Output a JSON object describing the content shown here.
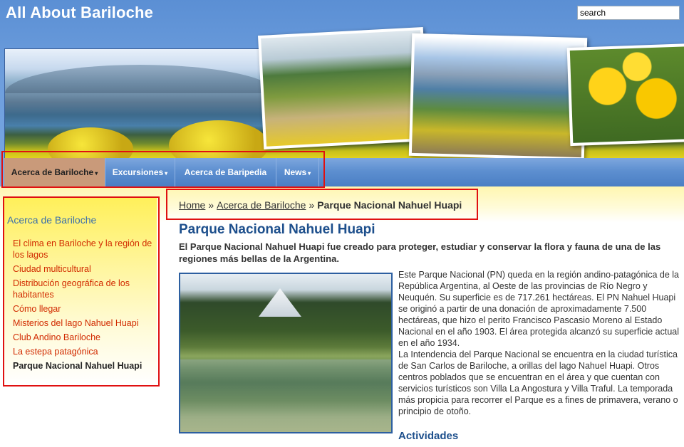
{
  "site": {
    "title": "All About Bariloche"
  },
  "search": {
    "value": "search"
  },
  "nav": {
    "items": [
      {
        "label": "Acerca de Bariloche",
        "caret": "▾"
      },
      {
        "label": "Excursiones",
        "caret": "▾"
      },
      {
        "label": "Acerca de Baripedia",
        "caret": ""
      },
      {
        "label": "News",
        "caret": "▾"
      }
    ]
  },
  "sidebar": {
    "title": "Acerca de Bariloche",
    "items": [
      "El clima en Bariloche y la región de los lagos",
      "Ciudad multicultural",
      "Distribución geográfica de los habitantes",
      "Cómo llegar",
      "Misterios del lago Nahuel Huapi",
      "Club Andino Bariloche",
      "La estepa patagónica",
      "Parque Nacional Nahuel Huapi"
    ]
  },
  "breadcrumb": {
    "home": "Home",
    "sep": "»",
    "section": "Acerca de Bariloche",
    "current": "Parque Nacional Nahuel Huapi"
  },
  "main": {
    "title": "Parque Nacional Nahuel Huapi",
    "lead": "El Parque Nacional Nahuel Huapi fue creado para proteger, estudiar y conservar la flora y fauna de una de las regiones más bellas de la Argentina.",
    "para1": "Este Parque Nacional (PN) queda en la región andino-patagónica de la República Argentina, al Oeste de las provincias de Río Negro y Neuquén. Su superficie es de 717.261 hectáreas. El PN Nahuel Huapi se originó a partir de una donación de aproximadamente 7.500 hectáreas, que hizo el perito Francisco Pascasio Moreno al Estado Nacional en el año 1903. El área protegida alcanzó su superficie actual en el año 1934.",
    "para2": "La Intendencia del Parque Nacional se encuentra en la ciudad turística de San Carlos de Bariloche, a orillas del lago Nahuel Huapi. Otros centros poblados que se encuentran en el área y que cuentan con servicios turísticos son Villa La Angostura y Villa Traful. La temporada más propicia para recorrer el Parque es a fines de primavera, verano o principio de otoño.",
    "activities_heading": "Actividades"
  }
}
